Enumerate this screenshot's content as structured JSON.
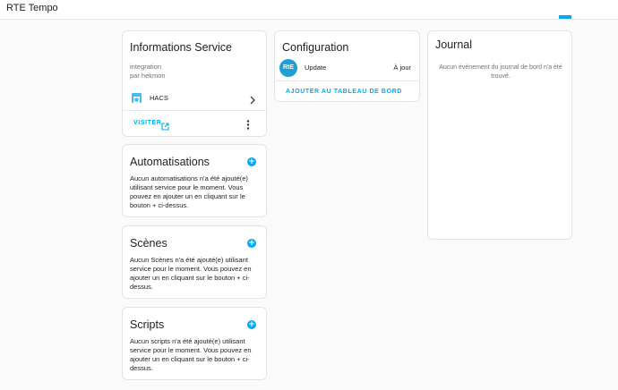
{
  "app": {
    "title": "RTE Tempo"
  },
  "service_info": {
    "title": "Informations Service",
    "type": "integration",
    "author": "par hekmon",
    "hacs_label": "HACS",
    "visit_label": "VISITER"
  },
  "configuration": {
    "title": "Configuration",
    "logo_text": "RtE",
    "entry_label": "Update",
    "entry_status": "À jour",
    "add_dashboard_label": "AJOUTER AU TABLEAU DE BORD"
  },
  "journal": {
    "title": "Journal",
    "empty_text": "Aucun événement du journal de bord n'a été trouvé."
  },
  "automations": {
    "title": "Automatisations",
    "text": "Aucun automatisations n'a été ajouté(e) utilisant service pour le moment. Vous pouvez en ajouter un en cliquant sur le bouton + ci-dessus."
  },
  "scenes": {
    "title": "Scènes",
    "text": "Aucun Scènes n'a été ajouté(e) utilisant service pour le moment. Vous pouvez en ajouter un en cliquant sur le bouton + ci-dessus."
  },
  "scripts": {
    "title": "Scripts",
    "text": "Aucun scripts n'a été ajouté(e) utilisant service pour le moment. Vous pouvez en ajouter un en cliquant sur le bouton + ci-dessus."
  },
  "colors": {
    "accent": "#03a9f4",
    "background": "#fafafa",
    "card": "#ffffff"
  },
  "icons": [
    "hacs-icon",
    "chevron-right-icon",
    "open-in-new-icon",
    "more-vertical-icon",
    "add-circle-icon"
  ]
}
